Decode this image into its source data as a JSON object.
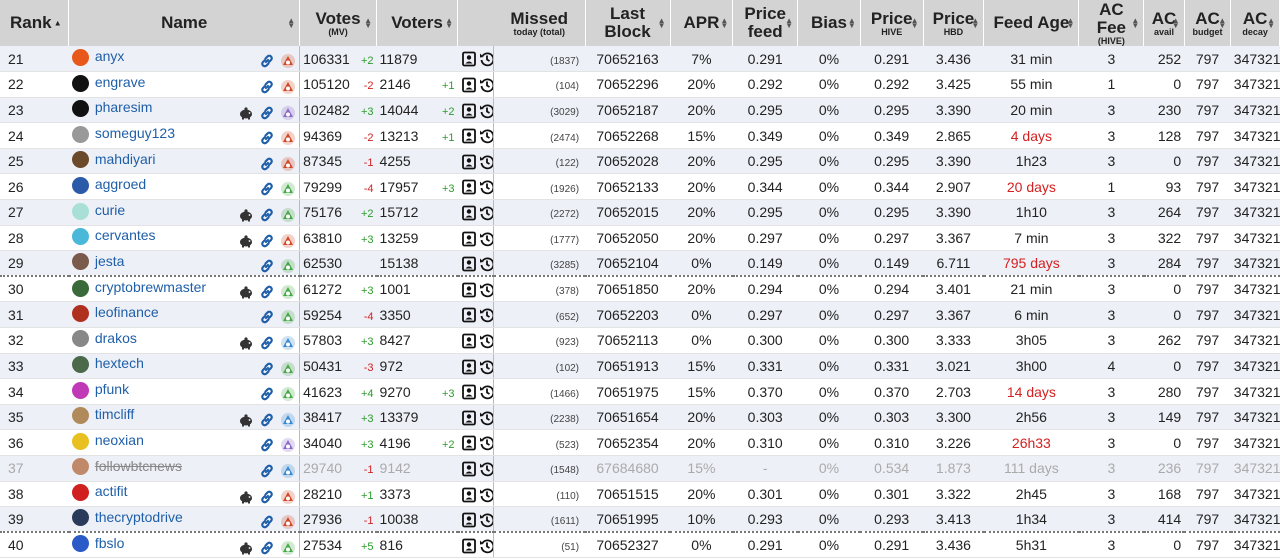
{
  "columns": [
    {
      "label": "Rank",
      "sub": "",
      "sort": "asc"
    },
    {
      "label": "Name",
      "sub": "",
      "sort": "none"
    },
    {
      "label": "Votes",
      "sub": "(MV)",
      "sort": "both"
    },
    {
      "label": "Voters",
      "sub": "",
      "sort": "both"
    },
    {
      "label": "Missed",
      "sub": "today (total)",
      "sort": "none"
    },
    {
      "label": "Last Block",
      "sub": "",
      "sort": "both"
    },
    {
      "label": "APR",
      "sub": "",
      "sort": "both"
    },
    {
      "label": "Price feed",
      "sub": "",
      "sort": "both"
    },
    {
      "label": "Bias",
      "sub": "",
      "sort": "both"
    },
    {
      "label": "Price",
      "sub": "HIVE",
      "sort": "both"
    },
    {
      "label": "Price",
      "sub": "HBD",
      "sort": "both"
    },
    {
      "label": "Feed Age",
      "sub": "",
      "sort": "both"
    },
    {
      "label": "AC Fee",
      "sub": "(HIVE)",
      "sort": "both"
    },
    {
      "label": "AC",
      "sub": "avail",
      "sort": "both"
    },
    {
      "label": "AC",
      "sub": "budget",
      "sort": "both"
    },
    {
      "label": "AC",
      "sub": "decay",
      "sort": "both"
    }
  ],
  "rows": [
    {
      "rank": "21",
      "name": "anyx",
      "avatar": "#e8581a",
      "pig": false,
      "status_icon": "red",
      "votes": "106331",
      "votes_chg": "+2",
      "voters": "11879",
      "voters_chg": "",
      "missed": "(1837)",
      "last_block": "70652163",
      "apr": "7%",
      "price_feed": "0.291",
      "bias": "0%",
      "price_hive": "0.291",
      "price_hbd": "3.436",
      "feed_age": "31 min",
      "feed_age_red": false,
      "ac_fee": "3",
      "ac_avail": "252",
      "ac_budget": "797",
      "ac_decay": "347321",
      "disabled": false
    },
    {
      "rank": "22",
      "name": "engrave",
      "avatar": "#111",
      "pig": false,
      "status_icon": "red",
      "votes": "105120",
      "votes_chg": "-2",
      "voters": "2146",
      "voters_chg": "+1",
      "missed": "(104)",
      "last_block": "70652296",
      "apr": "20%",
      "price_feed": "0.292",
      "bias": "0%",
      "price_hive": "0.292",
      "price_hbd": "3.425",
      "feed_age": "55 min",
      "feed_age_red": false,
      "ac_fee": "1",
      "ac_avail": "0",
      "ac_budget": "797",
      "ac_decay": "347321",
      "disabled": false
    },
    {
      "rank": "23",
      "name": "pharesim",
      "avatar": "#111",
      "pig": true,
      "status_icon": "purple",
      "votes": "102482",
      "votes_chg": "+3",
      "voters": "14044",
      "voters_chg": "+2",
      "missed": "(3029)",
      "last_block": "70652187",
      "apr": "20%",
      "price_feed": "0.295",
      "bias": "0%",
      "price_hive": "0.295",
      "price_hbd": "3.390",
      "feed_age": "20 min",
      "feed_age_red": false,
      "ac_fee": "3",
      "ac_avail": "230",
      "ac_budget": "797",
      "ac_decay": "347321",
      "disabled": false
    },
    {
      "rank": "24",
      "name": "someguy123",
      "avatar": "#999",
      "pig": false,
      "status_icon": "red",
      "votes": "94369",
      "votes_chg": "-2",
      "voters": "13213",
      "voters_chg": "+1",
      "missed": "(2474)",
      "last_block": "70652268",
      "apr": "15%",
      "price_feed": "0.349",
      "bias": "0%",
      "price_hive": "0.349",
      "price_hbd": "2.865",
      "feed_age": "4 days",
      "feed_age_red": true,
      "ac_fee": "3",
      "ac_avail": "128",
      "ac_budget": "797",
      "ac_decay": "347321",
      "disabled": false
    },
    {
      "rank": "25",
      "name": "mahdiyari",
      "avatar": "#6b4a2b",
      "pig": false,
      "status_icon": "red",
      "votes": "87345",
      "votes_chg": "-1",
      "voters": "4255",
      "voters_chg": "",
      "missed": "(122)",
      "last_block": "70652028",
      "apr": "20%",
      "price_feed": "0.295",
      "bias": "0%",
      "price_hive": "0.295",
      "price_hbd": "3.390",
      "feed_age": "1h23",
      "feed_age_red": false,
      "ac_fee": "3",
      "ac_avail": "0",
      "ac_budget": "797",
      "ac_decay": "347321",
      "disabled": false
    },
    {
      "rank": "26",
      "name": "aggroed",
      "avatar": "#2a5aa8",
      "pig": false,
      "status_icon": "green",
      "votes": "79299",
      "votes_chg": "-4",
      "voters": "17957",
      "voters_chg": "+3",
      "missed": "(1926)",
      "last_block": "70652133",
      "apr": "20%",
      "price_feed": "0.344",
      "bias": "0%",
      "price_hive": "0.344",
      "price_hbd": "2.907",
      "feed_age": "20 days",
      "feed_age_red": true,
      "ac_fee": "1",
      "ac_avail": "93",
      "ac_budget": "797",
      "ac_decay": "347321",
      "disabled": false
    },
    {
      "rank": "27",
      "name": "curie",
      "avatar": "#a8e0d8",
      "pig": true,
      "status_icon": "green",
      "votes": "75176",
      "votes_chg": "+2",
      "voters": "15712",
      "voters_chg": "",
      "missed": "(2272)",
      "last_block": "70652015",
      "apr": "20%",
      "price_feed": "0.295",
      "bias": "0%",
      "price_hive": "0.295",
      "price_hbd": "3.390",
      "feed_age": "1h10",
      "feed_age_red": false,
      "ac_fee": "3",
      "ac_avail": "264",
      "ac_budget": "797",
      "ac_decay": "347321",
      "disabled": false
    },
    {
      "rank": "28",
      "name": "cervantes",
      "avatar": "#4ab8d8",
      "pig": true,
      "status_icon": "red",
      "votes": "63810",
      "votes_chg": "+3",
      "voters": "13259",
      "voters_chg": "",
      "missed": "(1777)",
      "last_block": "70652050",
      "apr": "20%",
      "price_feed": "0.297",
      "bias": "0%",
      "price_hive": "0.297",
      "price_hbd": "3.367",
      "feed_age": "7 min",
      "feed_age_red": false,
      "ac_fee": "3",
      "ac_avail": "322",
      "ac_budget": "797",
      "ac_decay": "347321",
      "disabled": false
    },
    {
      "rank": "29",
      "name": "jesta",
      "avatar": "#7a5a4a",
      "pig": false,
      "status_icon": "green",
      "votes": "62530",
      "votes_chg": "",
      "voters": "15138",
      "voters_chg": "",
      "missed": "(3285)",
      "last_block": "70652104",
      "apr": "0%",
      "price_feed": "0.149",
      "bias": "0%",
      "price_hive": "0.149",
      "price_hbd": "6.711",
      "feed_age": "795 days",
      "feed_age_red": true,
      "ac_fee": "3",
      "ac_avail": "284",
      "ac_budget": "797",
      "ac_decay": "347321",
      "disabled": false
    },
    {
      "rank": "30",
      "name": "cryptobrewmaster",
      "avatar": "#3a6a3a",
      "pig": true,
      "status_icon": "green",
      "votes": "61272",
      "votes_chg": "+3",
      "voters": "1001",
      "voters_chg": "",
      "missed": "(378)",
      "last_block": "70651850",
      "apr": "20%",
      "price_feed": "0.294",
      "bias": "0%",
      "price_hive": "0.294",
      "price_hbd": "3.401",
      "feed_age": "21 min",
      "feed_age_red": false,
      "ac_fee": "3",
      "ac_avail": "0",
      "ac_budget": "797",
      "ac_decay": "347321",
      "disabled": false
    },
    {
      "rank": "31",
      "name": "leofinance",
      "avatar": "#b03020",
      "pig": false,
      "status_icon": "green",
      "votes": "59254",
      "votes_chg": "-4",
      "voters": "3350",
      "voters_chg": "",
      "missed": "(652)",
      "last_block": "70652203",
      "apr": "0%",
      "price_feed": "0.297",
      "bias": "0%",
      "price_hive": "0.297",
      "price_hbd": "3.367",
      "feed_age": "6 min",
      "feed_age_red": false,
      "ac_fee": "3",
      "ac_avail": "0",
      "ac_budget": "797",
      "ac_decay": "347321",
      "disabled": false
    },
    {
      "rank": "32",
      "name": "drakos",
      "avatar": "#888",
      "pig": true,
      "status_icon": "blue",
      "votes": "57803",
      "votes_chg": "+3",
      "voters": "8427",
      "voters_chg": "",
      "missed": "(923)",
      "last_block": "70652113",
      "apr": "0%",
      "price_feed": "0.300",
      "bias": "0%",
      "price_hive": "0.300",
      "price_hbd": "3.333",
      "feed_age": "3h05",
      "feed_age_red": false,
      "ac_fee": "3",
      "ac_avail": "262",
      "ac_budget": "797",
      "ac_decay": "347321",
      "disabled": false
    },
    {
      "rank": "33",
      "name": "hextech",
      "avatar": "#4a6a4a",
      "pig": false,
      "status_icon": "green",
      "votes": "50431",
      "votes_chg": "-3",
      "voters": "972",
      "voters_chg": "",
      "missed": "(102)",
      "last_block": "70651913",
      "apr": "15%",
      "price_feed": "0.331",
      "bias": "0%",
      "price_hive": "0.331",
      "price_hbd": "3.021",
      "feed_age": "3h00",
      "feed_age_red": false,
      "ac_fee": "4",
      "ac_avail": "0",
      "ac_budget": "797",
      "ac_decay": "347321",
      "disabled": false
    },
    {
      "rank": "34",
      "name": "pfunk",
      "avatar": "#c03ab8",
      "pig": false,
      "status_icon": "green",
      "votes": "41623",
      "votes_chg": "+4",
      "voters": "9270",
      "voters_chg": "+3",
      "missed": "(1466)",
      "last_block": "70651975",
      "apr": "15%",
      "price_feed": "0.370",
      "bias": "0%",
      "price_hive": "0.370",
      "price_hbd": "2.703",
      "feed_age": "14 days",
      "feed_age_red": true,
      "ac_fee": "3",
      "ac_avail": "280",
      "ac_budget": "797",
      "ac_decay": "347321",
      "disabled": false
    },
    {
      "rank": "35",
      "name": "timcliff",
      "avatar": "#b08a5a",
      "pig": true,
      "status_icon": "blue",
      "votes": "38417",
      "votes_chg": "+3",
      "voters": "13379",
      "voters_chg": "",
      "missed": "(2238)",
      "last_block": "70651654",
      "apr": "20%",
      "price_feed": "0.303",
      "bias": "0%",
      "price_hive": "0.303",
      "price_hbd": "3.300",
      "feed_age": "2h56",
      "feed_age_red": false,
      "ac_fee": "3",
      "ac_avail": "149",
      "ac_budget": "797",
      "ac_decay": "347321",
      "disabled": false
    },
    {
      "rank": "36",
      "name": "neoxian",
      "avatar": "#e8c020",
      "pig": false,
      "status_icon": "purple",
      "votes": "34040",
      "votes_chg": "+3",
      "voters": "4196",
      "voters_chg": "+2",
      "missed": "(523)",
      "last_block": "70652354",
      "apr": "20%",
      "price_feed": "0.310",
      "bias": "0%",
      "price_hive": "0.310",
      "price_hbd": "3.226",
      "feed_age": "26h33",
      "feed_age_red": true,
      "ac_fee": "3",
      "ac_avail": "0",
      "ac_budget": "797",
      "ac_decay": "347321",
      "disabled": false
    },
    {
      "rank": "37",
      "name": "followbtcnews",
      "avatar": "#c08a6a",
      "pig": false,
      "status_icon": "blue",
      "votes": "29740",
      "votes_chg": "-1",
      "voters": "9142",
      "voters_chg": "",
      "missed": "(1548)",
      "last_block": "67684680",
      "apr": "15%",
      "price_feed": "-",
      "bias": "0%",
      "price_hive": "0.534",
      "price_hbd": "1.873",
      "feed_age": "111 days",
      "feed_age_red": false,
      "ac_fee": "3",
      "ac_avail": "236",
      "ac_budget": "797",
      "ac_decay": "347321",
      "disabled": true
    },
    {
      "rank": "38",
      "name": "actifit",
      "avatar": "#d02020",
      "pig": true,
      "status_icon": "red",
      "votes": "28210",
      "votes_chg": "+1",
      "voters": "3373",
      "voters_chg": "",
      "missed": "(110)",
      "last_block": "70651515",
      "apr": "20%",
      "price_feed": "0.301",
      "bias": "0%",
      "price_hive": "0.301",
      "price_hbd": "3.322",
      "feed_age": "2h45",
      "feed_age_red": false,
      "ac_fee": "3",
      "ac_avail": "168",
      "ac_budget": "797",
      "ac_decay": "347321",
      "disabled": false
    },
    {
      "rank": "39",
      "name": "thecryptodrive",
      "avatar": "#2a3a5a",
      "pig": false,
      "status_icon": "red",
      "votes": "27936",
      "votes_chg": "-1",
      "voters": "10038",
      "voters_chg": "",
      "missed": "(1611)",
      "last_block": "70651995",
      "apr": "10%",
      "price_feed": "0.293",
      "bias": "0%",
      "price_hive": "0.293",
      "price_hbd": "3.413",
      "feed_age": "1h34",
      "feed_age_red": false,
      "ac_fee": "3",
      "ac_avail": "414",
      "ac_budget": "797",
      "ac_decay": "347321",
      "disabled": false
    },
    {
      "rank": "40",
      "name": "fbslo",
      "avatar": "#2a5ac8",
      "pig": true,
      "status_icon": "green",
      "votes": "27534",
      "votes_chg": "+5",
      "voters": "816",
      "voters_chg": "",
      "missed": "(51)",
      "last_block": "70652327",
      "apr": "0%",
      "price_feed": "0.291",
      "bias": "0%",
      "price_hive": "0.291",
      "price_hbd": "3.436",
      "feed_age": "5h31",
      "feed_age_red": false,
      "ac_fee": "3",
      "ac_avail": "0",
      "ac_budget": "797",
      "ac_decay": "347321",
      "disabled": false
    }
  ],
  "colors": {
    "link": "#1f5fa8",
    "header_bg": "#d3d3d3",
    "row_alt": "#eef0f7",
    "positive": "#2a9d2a",
    "negative": "#d02222",
    "stale": "#d42020",
    "status_red": "#d04a2a",
    "status_green": "#4aa84a",
    "status_blue": "#3a8ad0",
    "status_purple": "#8a6ac8"
  }
}
